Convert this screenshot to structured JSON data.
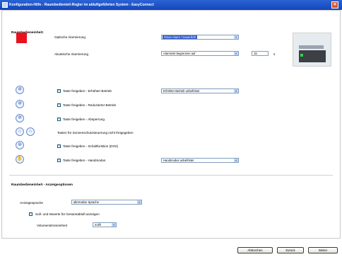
{
  "window": {
    "title": "Konfiguration-Hilfe - Raumbedienteil-Regler im abluftgeführten System - EasyConnect"
  },
  "section1": {
    "title": "Raumbedieneinheit:"
  },
  "alarm": {
    "optical_label": "Optische Alarmierung",
    "optical_value": "Rotes Alarm / Dauerlicht",
    "acoustic_label": "Akustische Alarmierung",
    "acoustic_value": "Alarmzeit begrenzen auf",
    "acoustic_seconds": "15",
    "acoustic_unit": "s",
    "indicator_color": "#e8121f"
  },
  "keys": [
    {
      "icon": "fan-icon",
      "checked": true,
      "label": "Taste freigeben - Erhöhter Betrieb",
      "select": "Erhöhter Betrieb unbefristet"
    },
    {
      "icon": "fan-icon",
      "checked": true,
      "label": "Taste freigeben - Reduzierter Betrieb",
      "select": ""
    },
    {
      "icon": "fan-icon",
      "checked": true,
      "label": "Taste freigeben - Absperrung",
      "select": ""
    },
    {
      "icon": "sash-icon",
      "checked": false,
      "label": "Tasten für Sonnenschutzsteuerung nicht freigegeben",
      "select": ""
    },
    {
      "icon": "switch-icon",
      "checked": true,
      "label": "Taste freigeben - Schaltfunktion (DO2)",
      "select": ""
    },
    {
      "icon": "hand-icon",
      "checked": true,
      "label": "Taste freigeben - Handmodus",
      "select": "Handmodus unbefristet"
    }
  ],
  "section2": {
    "title": "Raumbedieneinheit - Anzeigeoptionen"
  },
  "display": {
    "language_label": "Anzeigesprache",
    "language_value": "alternative Sprache",
    "show_setpoint_label": "Soll- und Istwerte für Gesamtabluft anzeigen",
    "show_setpoint_checked": true,
    "volume_unit_label": "Volumenstromeinheit",
    "volume_unit_value": "m3/h"
  },
  "buttons": {
    "cancel": "Abbrechen",
    "back": "Zurück",
    "next": "Weiter"
  }
}
